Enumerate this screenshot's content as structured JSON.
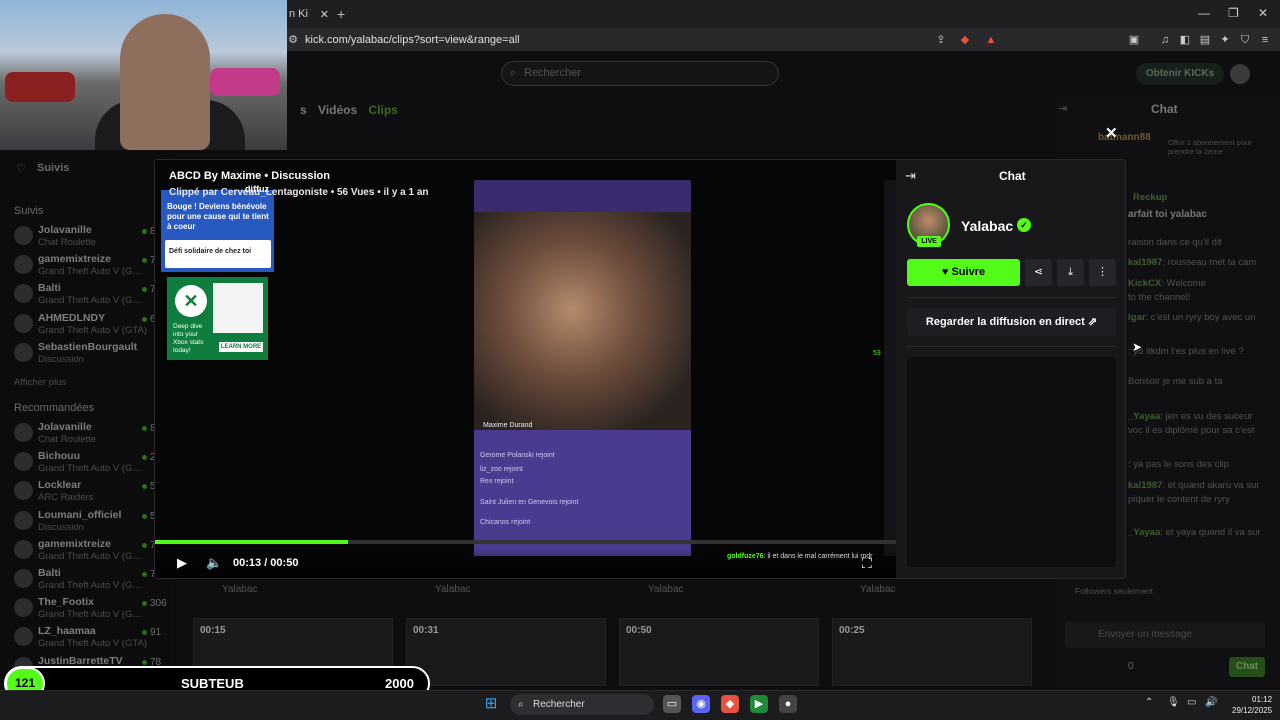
{
  "browser": {
    "tab_title": "n Ki",
    "tab_close": "✕",
    "new_tab": "+",
    "url": "kick.com/yalabac/clips?sort=view&range=all",
    "window_controls": [
      "—",
      "❐",
      "✕"
    ]
  },
  "site": {
    "search_placeholder": "Rechercher",
    "kicks_button": "Obtenir KICKs",
    "nav_tabs": [
      "s",
      "Vidéos",
      "Clips"
    ]
  },
  "sidebar": {
    "following_title": "Suivis",
    "following_label": "Suivis",
    "following": [
      {
        "name": "Jolavanille",
        "sub": "Chat Roulette",
        "count": "8,6"
      },
      {
        "name": "gamemixtreize",
        "sub": "Grand Theft Auto V (G...",
        "count": "71"
      },
      {
        "name": "Balti",
        "sub": "Grand Theft Auto V (G...",
        "count": "70"
      },
      {
        "name": "AHMEDLNDY",
        "sub": "Grand Theft Auto V (GTA)",
        "count": "6"
      },
      {
        "name": "SebastienBourgault",
        "sub": "Discussion",
        "count": ""
      }
    ],
    "show_more": "Afficher plus",
    "recommended_label": "Recommandées",
    "recommended": [
      {
        "name": "Jolavanille",
        "sub": "Chat Roulette",
        "count": "8,7"
      },
      {
        "name": "Bichouu",
        "sub": "Grand Theft Auto V (G...",
        "count": "2,2"
      },
      {
        "name": "Locklear",
        "sub": "ARC Raiders",
        "count": "5"
      },
      {
        "name": "Loumani_officiel",
        "sub": "Discussion",
        "count": "5"
      },
      {
        "name": "gamemixtreize",
        "sub": "Grand Theft Auto V (G...",
        "count": "71"
      },
      {
        "name": "Balti",
        "sub": "Grand Theft Auto V (G...",
        "count": "70"
      },
      {
        "name": "The_Footix",
        "sub": "Grand Theft Auto V (G...",
        "count": "306"
      },
      {
        "name": "LZ_haamaa",
        "sub": "Grand Theft Auto V (GTA)",
        "count": "91"
      },
      {
        "name": "JustinBarretteTV",
        "sub": "",
        "count": "78"
      }
    ]
  },
  "background_clips": {
    "labels": [
      "Yalabac",
      "Yalabac",
      "Yalabac",
      "Yalabac"
    ],
    "durations": [
      "00:15",
      "00:31",
      "00:50",
      "00:25"
    ]
  },
  "right_chat": {
    "title": "Chat",
    "top_user": "batmann88",
    "top_offer": "Offrir 1 abonnement pour prendre la 2ème",
    "pinned_user": "Reckup",
    "pinned_msg": "arfait toi yalabac",
    "lines": [
      {
        "user": "",
        "text": "raison dans ce qu'il dit"
      },
      {
        "user": "kal1987",
        "text": ": rousseau met ta cam"
      },
      {
        "user": "KickCX",
        "text": ": Welcome"
      },
      {
        "user": "",
        "text": "to the channel!"
      },
      {
        "user": "igar",
        "text": ": c'est un ryry boy avec un"
      },
      {
        "user": "",
        "text": ": yo itkdm t'es plus en live ?"
      },
      {
        "user": "",
        "text": "Bonsoir je me sub a ta"
      },
      {
        "user": "_Yayaa",
        "text": ": jen es vu des suceur"
      },
      {
        "user": "",
        "text": "voc il es diplômé pour sa c'est"
      },
      {
        "user": "",
        "text": ": ya pas le sons des clip"
      },
      {
        "user": "kal1987",
        "text": ": et quand akaru va sur"
      },
      {
        "user": "",
        "text": "piquer le content de ryry"
      },
      {
        "user": "_Yayaa",
        "text": ": et yaya quand il va sur"
      }
    ],
    "followers_only": "Followers seulement",
    "input_placeholder": "Envoyer un message",
    "count": "0",
    "send_button": "Chat"
  },
  "modal": {
    "clip_title": "ABCD By Maxime • Discussion",
    "clip_meta": "Clippé par Cerveau_Lentagoniste • 56 Vues • il y a 1 an",
    "ad1_tag": "diffuz",
    "ad1_text": "Bouge ! Deviens bénévole pour une cause qui te tient à coeur",
    "ad1_sub": "Défi solidaire de chez toi",
    "ad2_text": "Deep dive into your Xbox stats today!",
    "ad2_button": "LEARN MORE",
    "streamer_in_video": "Maxime Durand",
    "phone_lines": [
      "Gerome Polanski rejoint",
      "liz_zoo rejoint",
      "Rex rejoint",
      "Saint Julien en Genevois rejoint",
      "Chicanos rejoint"
    ],
    "viewer_count": "53",
    "time": "00:13 / 00:50",
    "progress_fraction": 0.26,
    "overlay_user": "goldfuze76",
    "overlay_msg": ": il et dans le mal carrément lui mdr",
    "panel_title": "Chat",
    "channel_name": "Yalabac",
    "live_badge": "LIVE",
    "follow_button": "Suivre",
    "watch_live": "Regarder la diffusion en direct",
    "close": "✕"
  },
  "overlay": {
    "sub_count": "121",
    "sub_label": "SUBTEUB",
    "sub_goal": "2000"
  },
  "taskbar": {
    "search": "Rechercher",
    "time": "01:12",
    "date": "29/12/2025"
  },
  "colors": {
    "accent": "#53fc18",
    "bg": "#0e0e10",
    "panel": "#18181b"
  }
}
